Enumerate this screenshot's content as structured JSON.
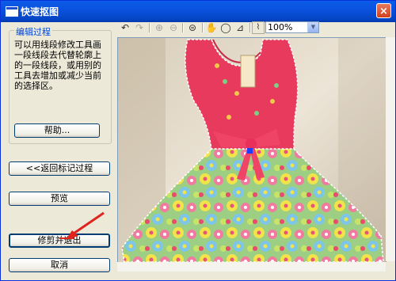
{
  "window": {
    "title": "快速抠图",
    "close_label": "×"
  },
  "left_panel": {
    "group_title": "编辑过程",
    "description": "可以用线段修改工具画一段线段去代替轮廓上的一段线段，或用别的工具去增加或减少当前的选择区。",
    "help_button": "帮助...",
    "back_button": "<<返回标记过程",
    "preview_button": "预览",
    "crop_button": "修剪并退出",
    "cancel_button": "取消"
  },
  "toolbar": {
    "zoom_value": "100%"
  }
}
